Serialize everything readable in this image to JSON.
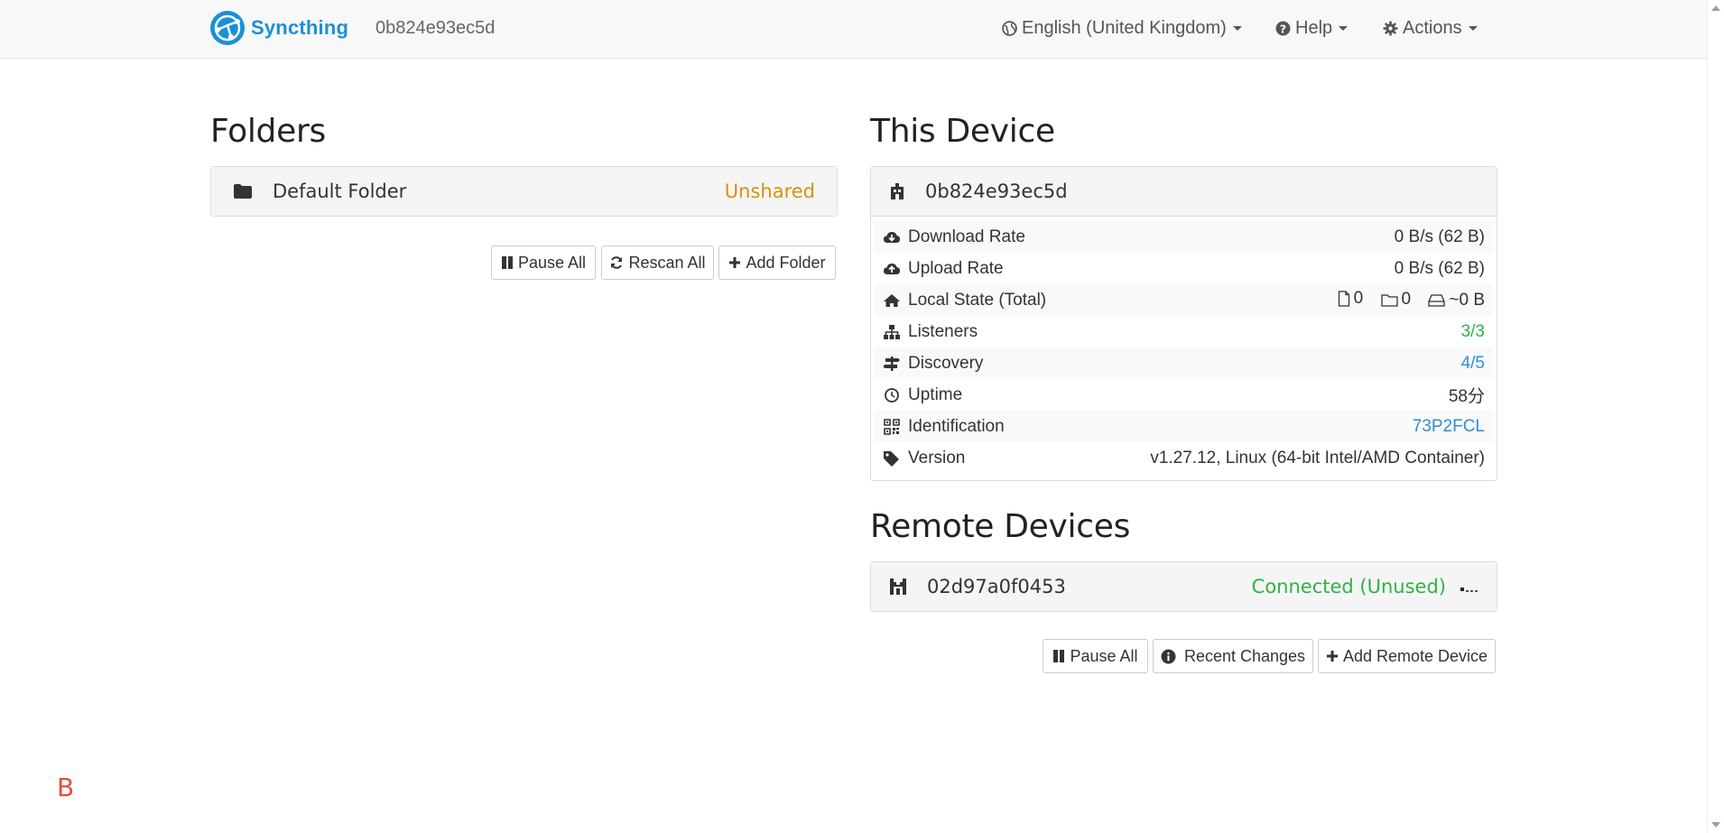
{
  "navbar": {
    "brand": "Syncthing",
    "device_id": "0b824e93ec5d",
    "language": "English (United Kingdom)",
    "help": "Help",
    "actions": "Actions"
  },
  "folders": {
    "title": "Folders",
    "items": [
      {
        "name": "Default Folder",
        "status": "Unshared"
      }
    ],
    "buttons": {
      "pause_all": "Pause All",
      "rescan_all": "Rescan All",
      "add_folder": "Add Folder"
    }
  },
  "this_device": {
    "title": "This Device",
    "name": "0b824e93ec5d",
    "rows": {
      "download_rate": {
        "label": "Download Rate",
        "value": "0 B/s (62 B)"
      },
      "upload_rate": {
        "label": "Upload Rate",
        "value": "0 B/s (62 B)"
      },
      "local_state": {
        "label": "Local State (Total)",
        "files": "0",
        "dirs": "0",
        "size": "~0 B"
      },
      "listeners": {
        "label": "Listeners",
        "value": "3/3"
      },
      "discovery": {
        "label": "Discovery",
        "value": "4/5"
      },
      "uptime": {
        "label": "Uptime",
        "value": "58分"
      },
      "identification": {
        "label": "Identification",
        "value": "73P2FCL"
      },
      "version": {
        "label": "Version",
        "value": "v1.27.12, Linux (64-bit Intel/AMD Container)"
      }
    }
  },
  "remote_devices": {
    "title": "Remote Devices",
    "items": [
      {
        "name": "02d97a0f0453",
        "status": "Connected (Unused)"
      }
    ],
    "buttons": {
      "pause_all": "Pause All",
      "recent_changes": "Recent Changes",
      "add_remote_device": "Add Remote Device"
    }
  },
  "corner_letter": "B",
  "colors": {
    "brand": "#1b8fd8",
    "unshared": "#d9900f",
    "connected": "#2fb344",
    "link": "#2d8fd8",
    "corner": "#e74c3c"
  }
}
